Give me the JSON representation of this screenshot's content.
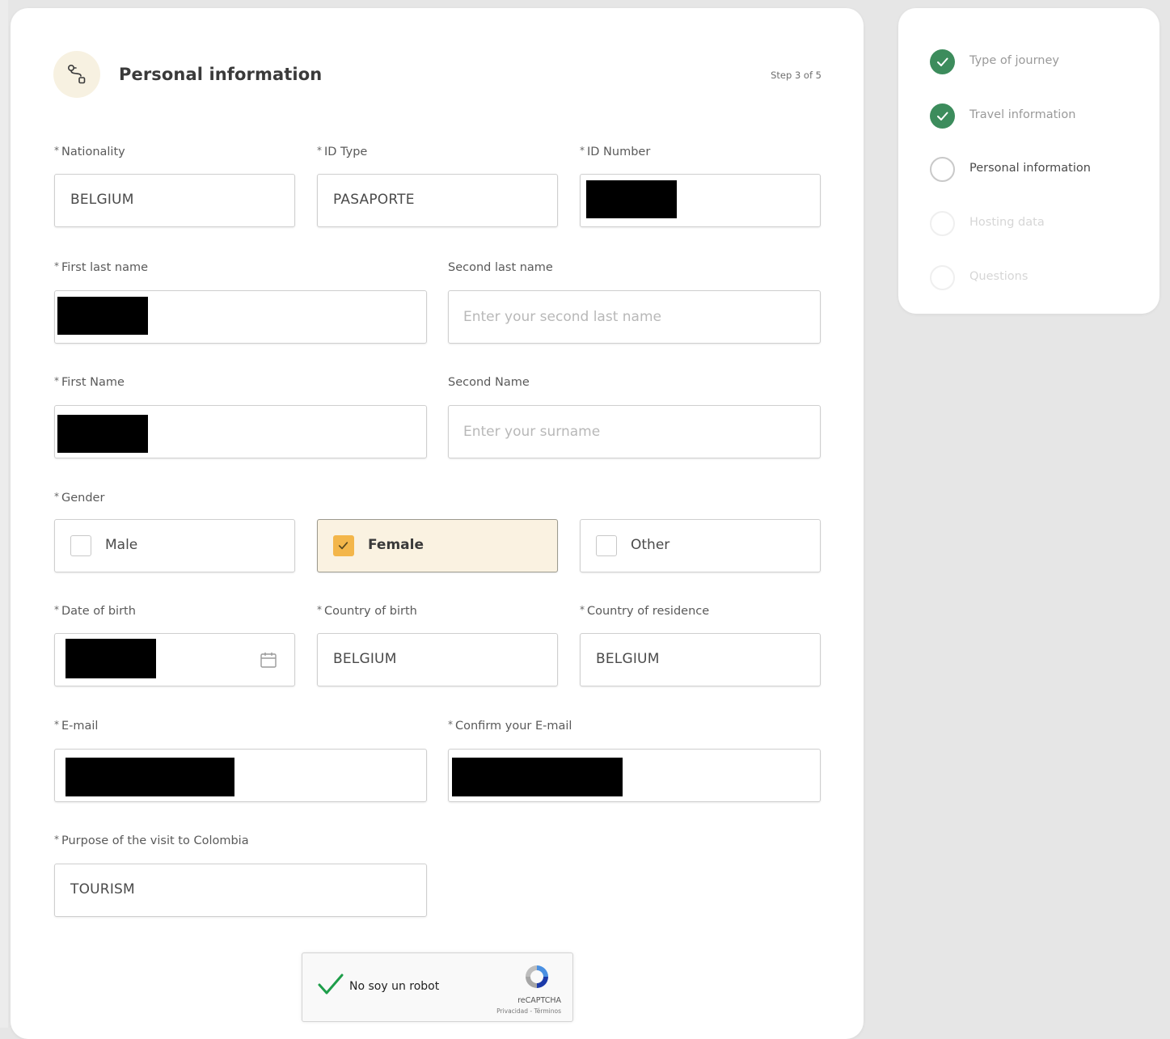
{
  "header": {
    "title": "Personal information",
    "step": "Step 3 of 5"
  },
  "form": {
    "required_mark": "*",
    "nationality": {
      "label": "Nationality",
      "value": "BELGIUM"
    },
    "id_type": {
      "label": "ID Type",
      "value": "PASAPORTE"
    },
    "id_number": {
      "label": "ID Number",
      "value": ""
    },
    "first_last_name": {
      "label": "First last name",
      "value": ""
    },
    "second_last_name": {
      "label": "Second last name",
      "placeholder": "Enter your second last name"
    },
    "first_name": {
      "label": "First Name",
      "value": ""
    },
    "second_name": {
      "label": "Second Name",
      "placeholder": "Enter your surname"
    },
    "gender": {
      "label": "Gender",
      "options": [
        "Male",
        "Female",
        "Other"
      ],
      "selected": "Female"
    },
    "date_of_birth": {
      "label": "Date of birth",
      "value": ""
    },
    "country_of_birth": {
      "label": "Country of birth",
      "value": "BELGIUM"
    },
    "country_of_residence": {
      "label": "Country of residence",
      "value": "BELGIUM"
    },
    "email": {
      "label": "E-mail",
      "value": ""
    },
    "confirm_email": {
      "label": "Confirm your E-mail",
      "value": ""
    },
    "purpose": {
      "label": "Purpose of the visit to Colombia",
      "value": "TOURISM"
    }
  },
  "captcha": {
    "label": "No soy un robot",
    "brand": "reCAPTCHA",
    "terms": "Privacidad - Términos"
  },
  "steps": [
    {
      "label": "Type of journey",
      "status": "done"
    },
    {
      "label": "Travel information",
      "status": "done"
    },
    {
      "label": "Personal information",
      "status": "current"
    },
    {
      "label": "Hosting data",
      "status": "todo"
    },
    {
      "label": "Questions",
      "status": "todo"
    }
  ],
  "colors": {
    "accent_green": "#3c8c5c",
    "selected_bg": "#faf2e1",
    "checkbox_orange": "#f3b64a",
    "header_icon_bg": "#f7f1e1"
  }
}
